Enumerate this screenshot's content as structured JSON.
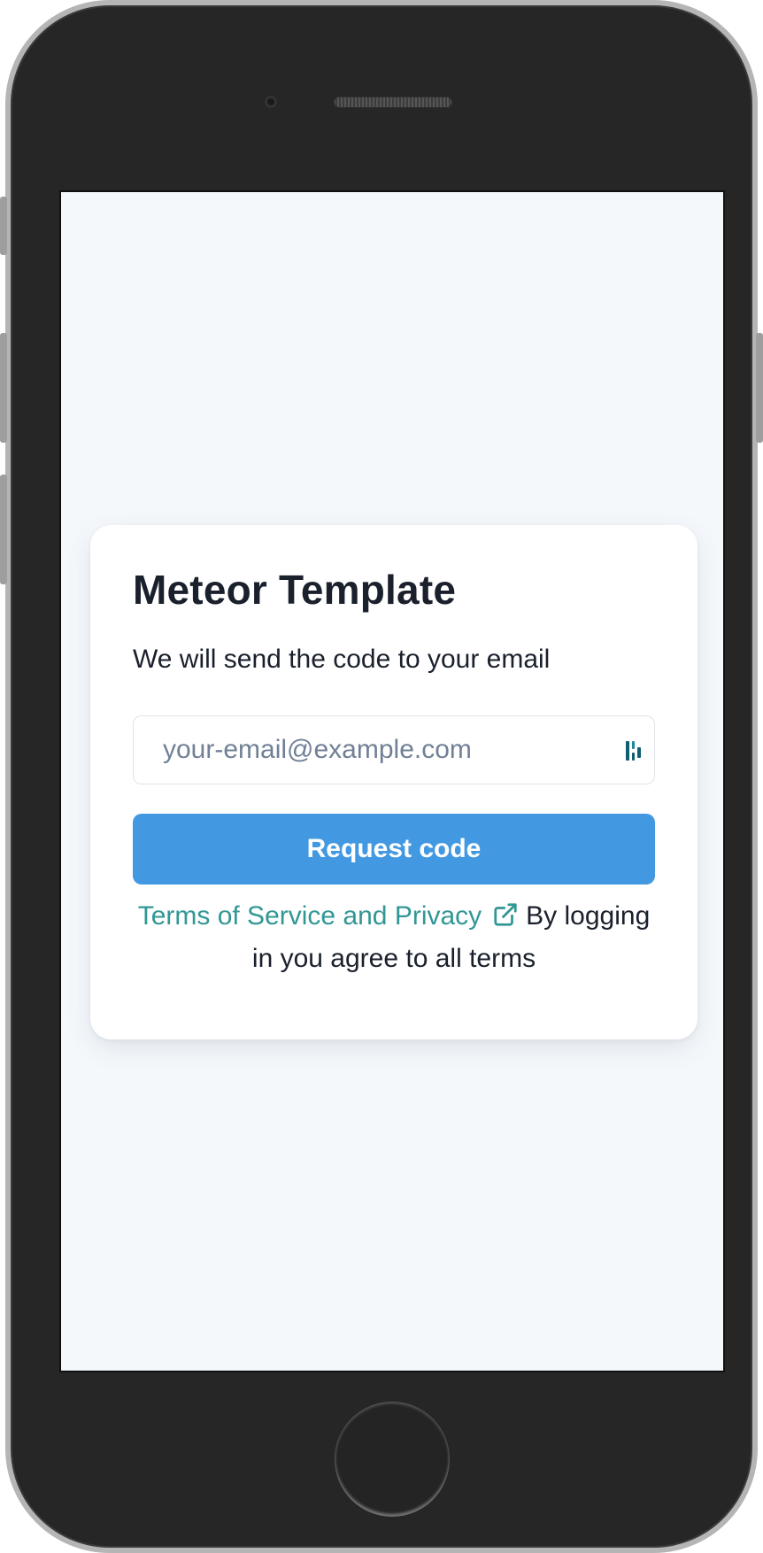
{
  "app": {
    "title": "Meteor Template"
  },
  "login": {
    "subtitle": "We will send the code to your email",
    "email_placeholder": "your-email@example.com",
    "email_value": "",
    "submit_label": "Request code",
    "terms_link_label": "Terms of Service and Privacy",
    "terms_text": "By logging in you agree to all terms"
  },
  "icons": {
    "password_manager": "password-manager-icon",
    "external_link": "external-link-icon"
  },
  "colors": {
    "primary_button": "#4299e1",
    "link": "#319795",
    "background": "#f5f8fb",
    "text": "#1a202c",
    "placeholder": "#718096"
  }
}
